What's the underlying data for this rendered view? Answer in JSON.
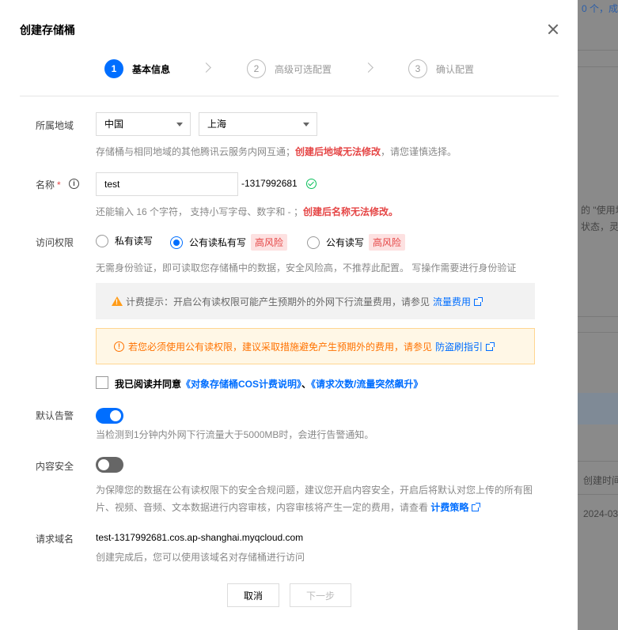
{
  "background": {
    "top_right_text": "0 个，成",
    "side_text_1": "的 \"使用场",
    "side_text_2": "状态，灵活",
    "column_header": "创建时间",
    "date_cell": "2024-03"
  },
  "modal": {
    "title": "创建存储桶",
    "steps": [
      {
        "num": "1",
        "label": "基本信息"
      },
      {
        "num": "2",
        "label": "高级可选配置"
      },
      {
        "num": "3",
        "label": "确认配置"
      }
    ]
  },
  "region": {
    "label": "所属地域",
    "country": "中国",
    "city": "上海",
    "help_prefix": "存储桶与相同地域的其他腾讯云服务内网互通；",
    "help_warn": "创建后地域无法修改",
    "help_suffix": "，请您谨慎选择。"
  },
  "name": {
    "label": "名称",
    "required_mark": "*",
    "info_icon": "i",
    "value": "test",
    "suffix": "-1317992681",
    "help_prefix": "还能输入 16 个字符， 支持小写字母、数字和 - ；",
    "help_warn": "创建后名称无法修改。"
  },
  "access": {
    "label": "访问权限",
    "options": [
      {
        "label": "私有读写",
        "risk": ""
      },
      {
        "label": "公有读私有写",
        "risk": "高风险"
      },
      {
        "label": "公有读写",
        "risk": "高风险"
      }
    ],
    "selected_index": 1,
    "help": "无需身份验证，即可读取您存储桶中的数据，安全风险高，不推荐此配置。 写操作需要进行身份验证",
    "notice_gray_text": "计费提示：开启公有读权限可能产生预期外的外网下行流量费用，请参见",
    "notice_gray_link": "流量费用",
    "notice_orange_text": "若您必须使用公有读权限，建议采取措施避免产生预期外的费用，请参见",
    "notice_orange_link": "防盗刷指引",
    "agree_prefix": "我已阅读并同意",
    "agree_link_1": "《对象存储桶COS计费说明》",
    "agree_sep": "、",
    "agree_link_2": "《请求次数/流量突然飙升》",
    "agreed": false
  },
  "alarm": {
    "label": "默认告警",
    "enabled": true,
    "help": "当检测到1分钟内外网下行流量大于5000MB时，会进行告警通知。"
  },
  "content_security": {
    "label": "内容安全",
    "enabled": false,
    "help_line1": "为保障您的数据在公有读权限下的安全合规问题，建议您开启内容安全，开启后将默认对您上传的所有图",
    "help_line2": "片、视频、音频、文本数据进行内容审核，内容审核将产生一定的费用，请查看",
    "help_link": "计费策略"
  },
  "domain": {
    "label": "请求域名",
    "value": "test-1317992681.cos.ap-shanghai.myqcloud.com",
    "help": "创建完成后，您可以使用该域名对存储桶进行访问"
  },
  "buttons": {
    "cancel": "取消",
    "next": "下一步"
  },
  "colors": {
    "primary": "#006eff",
    "danger": "#e54545",
    "warning": "#ff7200",
    "success": "#0abf5b"
  }
}
